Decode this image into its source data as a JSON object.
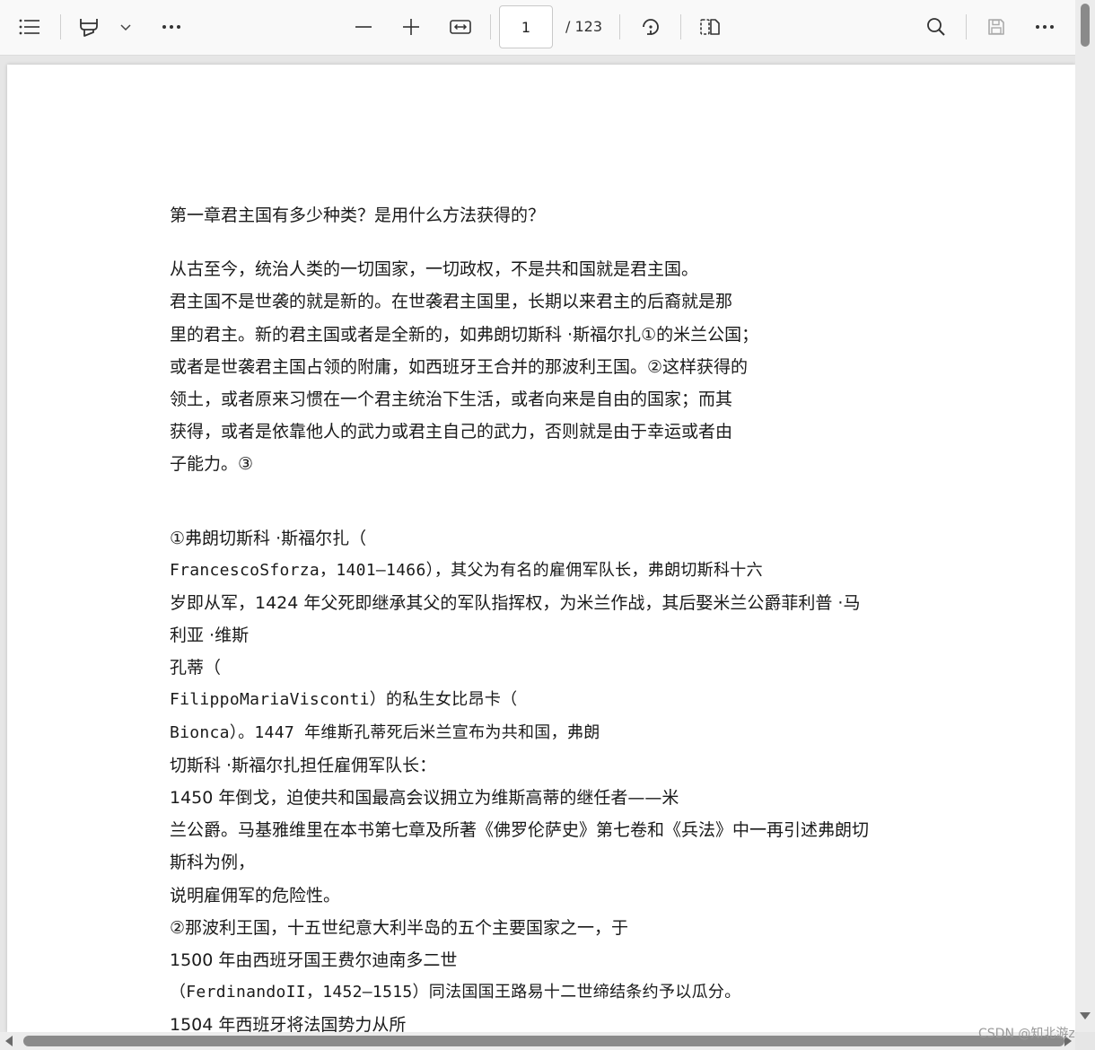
{
  "toolbar": {
    "page_current": "1",
    "page_total": "/ 123"
  },
  "document": {
    "lines": [
      "第一章君主国有多少种类？是用什么方法获得的？",
      "从古至今，统治人类的一切国家，一切政权，不是共和国就是君主国。",
      "君主国不是世袭的就是新的。在世袭君主国里，长期以来君主的后裔就是那",
      "里的君主。新的君主国或者是全新的，如弗朗切斯科 ·斯福尔扎①的米兰公国；",
      "或者是世袭君主国占领的附庸，如西班牙王合并的那波利王国。②这样获得的",
      "领土，或者原来习惯在一个君主统治下生活，或者向来是自由的国家；而其",
      "获得，或者是依靠他人的武力或君主自己的武力，否则就是由于幸运或者由",
      "子能力。③",
      "①弗朗切斯科 ·斯福尔扎（",
      "FrancescoSforza，1401—1466），其父为有名的雇佣军队长，弗朗切斯科十六",
      "岁即从军，1424 年父死即继承其父的军队指挥权，为米兰作战，其后娶米兰公爵菲利普 ·马",
      "利亚 ·维斯",
      "孔蒂（",
      "FilippoMariaVisconti）的私生女比昂卡（",
      "Bionca）。1447 年维斯孔蒂死后米兰宣布为共和国，弗朗",
      "切斯科 ·斯福尔扎担任雇佣军队长：",
      "1450 年倒戈，迫使共和国最高会议拥立为维斯高蒂的继任者——米",
      "兰公爵。马基雅维里在本书第七章及所著《佛罗伦萨史》第七卷和《兵法》中一再引述弗朗切",
      "斯科为例，",
      "说明雇佣军的危险性。",
      "②那波利王国，十五世纪意大利半岛的五个主要国家之一，于",
      "1500 年由西班牙国王费尔迪南多二世",
      "（FerdinandoII，1452—1515）同法国国王路易十二世缔结条约予以瓜分。",
      "1504 年西班牙将法国势力从所"
    ]
  },
  "watermark": "CSDN @知北游z",
  "icons": [
    "contents-icon",
    "draw-icon",
    "chevron-down-icon",
    "more-icon",
    "zoom-out-icon",
    "zoom-in-icon",
    "fit-width-icon",
    "rotate-icon",
    "page-view-icon",
    "search-icon",
    "save-icon",
    "more-options-icon"
  ]
}
